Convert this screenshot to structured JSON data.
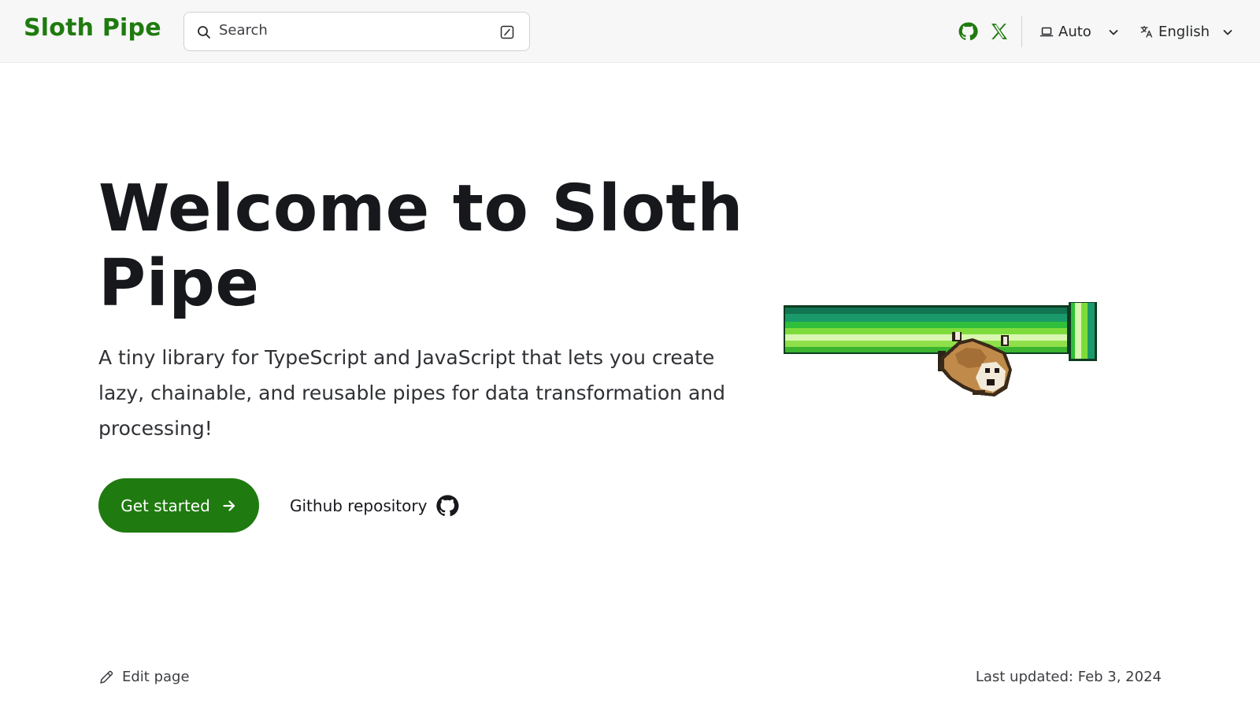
{
  "header": {
    "site_title": "Sloth Pipe",
    "search": {
      "placeholder": "Search",
      "icon": "search-icon",
      "shortcut_icon": "slash-key-icon"
    },
    "social": [
      {
        "name": "GitHub",
        "icon": "github-icon"
      },
      {
        "name": "X",
        "icon": "x-icon"
      }
    ],
    "theme_select": {
      "value": "Auto",
      "icon": "laptop-icon"
    },
    "language_select": {
      "value": "English",
      "icon": "translate-icon"
    }
  },
  "hero": {
    "title": "Welcome to Sloth Pipe",
    "tagline": "A tiny library for TypeScript and JavaScript that lets you create lazy, chainable, and reusable pipes for data transformation and processing!",
    "primary_action": {
      "label": "Get started",
      "icon": "arrow-right-icon"
    },
    "secondary_action": {
      "label": "Github repository",
      "icon": "github-icon"
    },
    "illustration": "sloth-hanging-on-green-pipe"
  },
  "footer": {
    "edit_label": "Edit page",
    "edit_icon": "pencil-icon",
    "last_updated": "Last updated: Feb 3, 2024"
  },
  "colors": {
    "accent": "#1f7a0f",
    "header_bg": "#f6f7f6",
    "text": "#17181c"
  }
}
